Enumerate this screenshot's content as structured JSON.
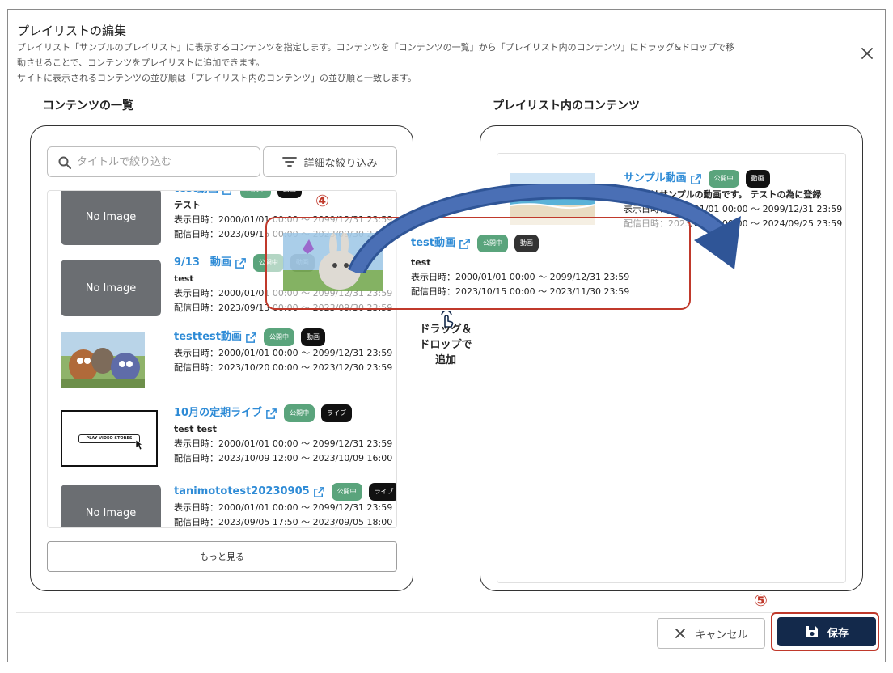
{
  "dialog": {
    "title": "プレイリストの編集",
    "desc_line1": "プレイリスト「サンプルのプレイリスト」に表示するコンテンツを指定します。コンテンツを「コンテンツの一覧」から「プレイリスト内のコンテンツ」にドラッグ&ドロップで移",
    "desc_line2": "動させることで、コンテンツをプレイリストに追加できます。",
    "desc_line3": "サイトに表示されるコンテンツの並び順は「プレイリスト内のコンテンツ」の並び順と一致します。"
  },
  "left": {
    "heading": "コンテンツの一覧",
    "search_placeholder": "タイトルで絞り込む",
    "filter_label": "詳細な絞り込み",
    "more_label": "もっと見る",
    "items": [
      {
        "title": "test動画",
        "badge1": "公開中",
        "badge2": "動画",
        "subtitle": "テスト",
        "display": "表示日時：2000/01/01 00:00 〜 2099/12/31 23:59",
        "delivery": "配信日時：2023/09/15 00:00 〜 2023/09/30 23:59",
        "thumb": "No Image"
      },
      {
        "title": "9/13　動画",
        "badge1": "公開中",
        "badge2": "動画",
        "subtitle": "test",
        "display": "表示日時：2000/01/01 00:00 〜 2099/12/31 23:59",
        "delivery": "配信日時：2023/09/13 00:00 〜 2023/09/30 23:59",
        "thumb": "No Image"
      },
      {
        "title": "testtest動画",
        "badge1": "公開中",
        "badge2": "動画",
        "subtitle": "",
        "display": "表示日時：2000/01/01 00:00 〜 2099/12/31 23:59",
        "delivery": "配信日時：2023/10/20 00:00 〜 2023/12/30 23:59",
        "thumb": ""
      },
      {
        "title": "10月の定期ライブ",
        "badge1": "公開中",
        "badge2": "ライブ",
        "subtitle": "test test",
        "display": "表示日時：2000/01/01 00:00 〜 2099/12/31 23:59",
        "delivery": "配信日時：2023/10/09 12:00 〜 2023/10/09 16:00",
        "thumb": "PLAY VIDEO STORES"
      },
      {
        "title": "tanimototest20230905",
        "badge1": "公開中",
        "badge2": "ライブ",
        "subtitle": "",
        "display": "表示日時：2000/01/01 00:00 〜 2099/12/31 23:59",
        "delivery": "配信日時：2023/09/05 17:50 〜 2023/09/05 18:00",
        "thumb": "No Image"
      }
    ]
  },
  "drag": {
    "step": "④",
    "title": "test動画",
    "badge1": "公開中",
    "badge2": "動画",
    "subtitle": "test",
    "display": "表示日時：2000/01/01 00:00 〜 2099/12/31 23:59",
    "delivery": "配信日時：2023/10/15 00:00 〜 2023/11/30 23:59",
    "caption_line1": "ドラッグ＆",
    "caption_line2": "ドロップで",
    "caption_line3": "追加"
  },
  "right": {
    "heading": "プレイリスト内のコンテンツ",
    "item": {
      "title": "サンプル動画",
      "badge1": "公開中",
      "badge2": "動画",
      "subtitle": "こちらはサンプルの動画です。 テストの為に登録",
      "display": "表示日時：2000/01/01 00:00 〜 2099/12/31 23:59",
      "delivery": "配信日時：2023/09/25 00:00 〜 2024/09/25 23:59"
    }
  },
  "footer": {
    "step": "⑤",
    "cancel_label": "キャンセル",
    "save_label": "保存"
  },
  "colors": {
    "accent": "#2e8bd6",
    "published": "#5aa47c",
    "save": "#13294b",
    "highlight": "#c0392b",
    "arrow": "#2f5597"
  }
}
